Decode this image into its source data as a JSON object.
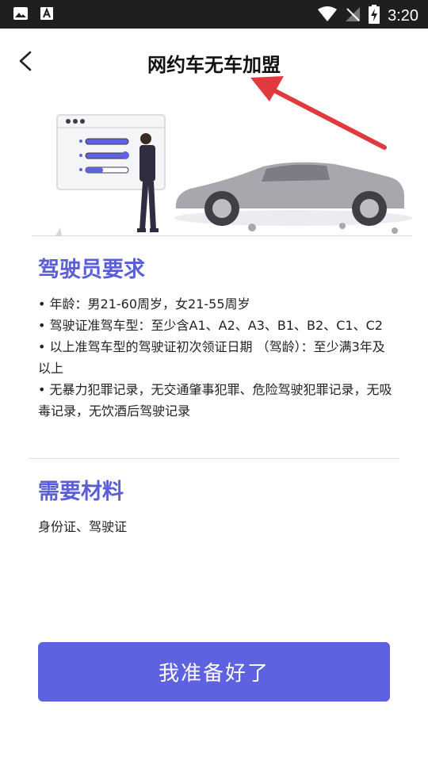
{
  "status_bar": {
    "time": "3:20",
    "icons": [
      "image-icon",
      "text-a-icon",
      "wifi-icon",
      "no-signal-icon",
      "battery-charging-icon"
    ]
  },
  "header": {
    "title": "网约车无车加盟",
    "back_icon": "back-arrow-icon"
  },
  "colors": {
    "accent": "#5e61e0",
    "section_title": "#5a5fd6",
    "annotation_arrow": "#e0393e"
  },
  "driver_requirements": {
    "title": "驾驶员要求",
    "items": [
      "• 年龄：男21-60周岁，女21-55周岁",
      "• 驾驶证准驾车型：至少含A1、A2、A3、B1、B2、C1、C2",
      "• 以上准驾车型的驾驶证初次领证日期 （驾龄）：至少满3年及以上",
      "• 无暴力犯罪记录，无交通肇事犯罪、危险驾驶犯罪记录，无吸毒记录，无饮酒后驾驶记录"
    ]
  },
  "materials": {
    "title": "需要材料",
    "text": "身份证、驾驶证"
  },
  "cta": {
    "label": "我准备好了"
  }
}
